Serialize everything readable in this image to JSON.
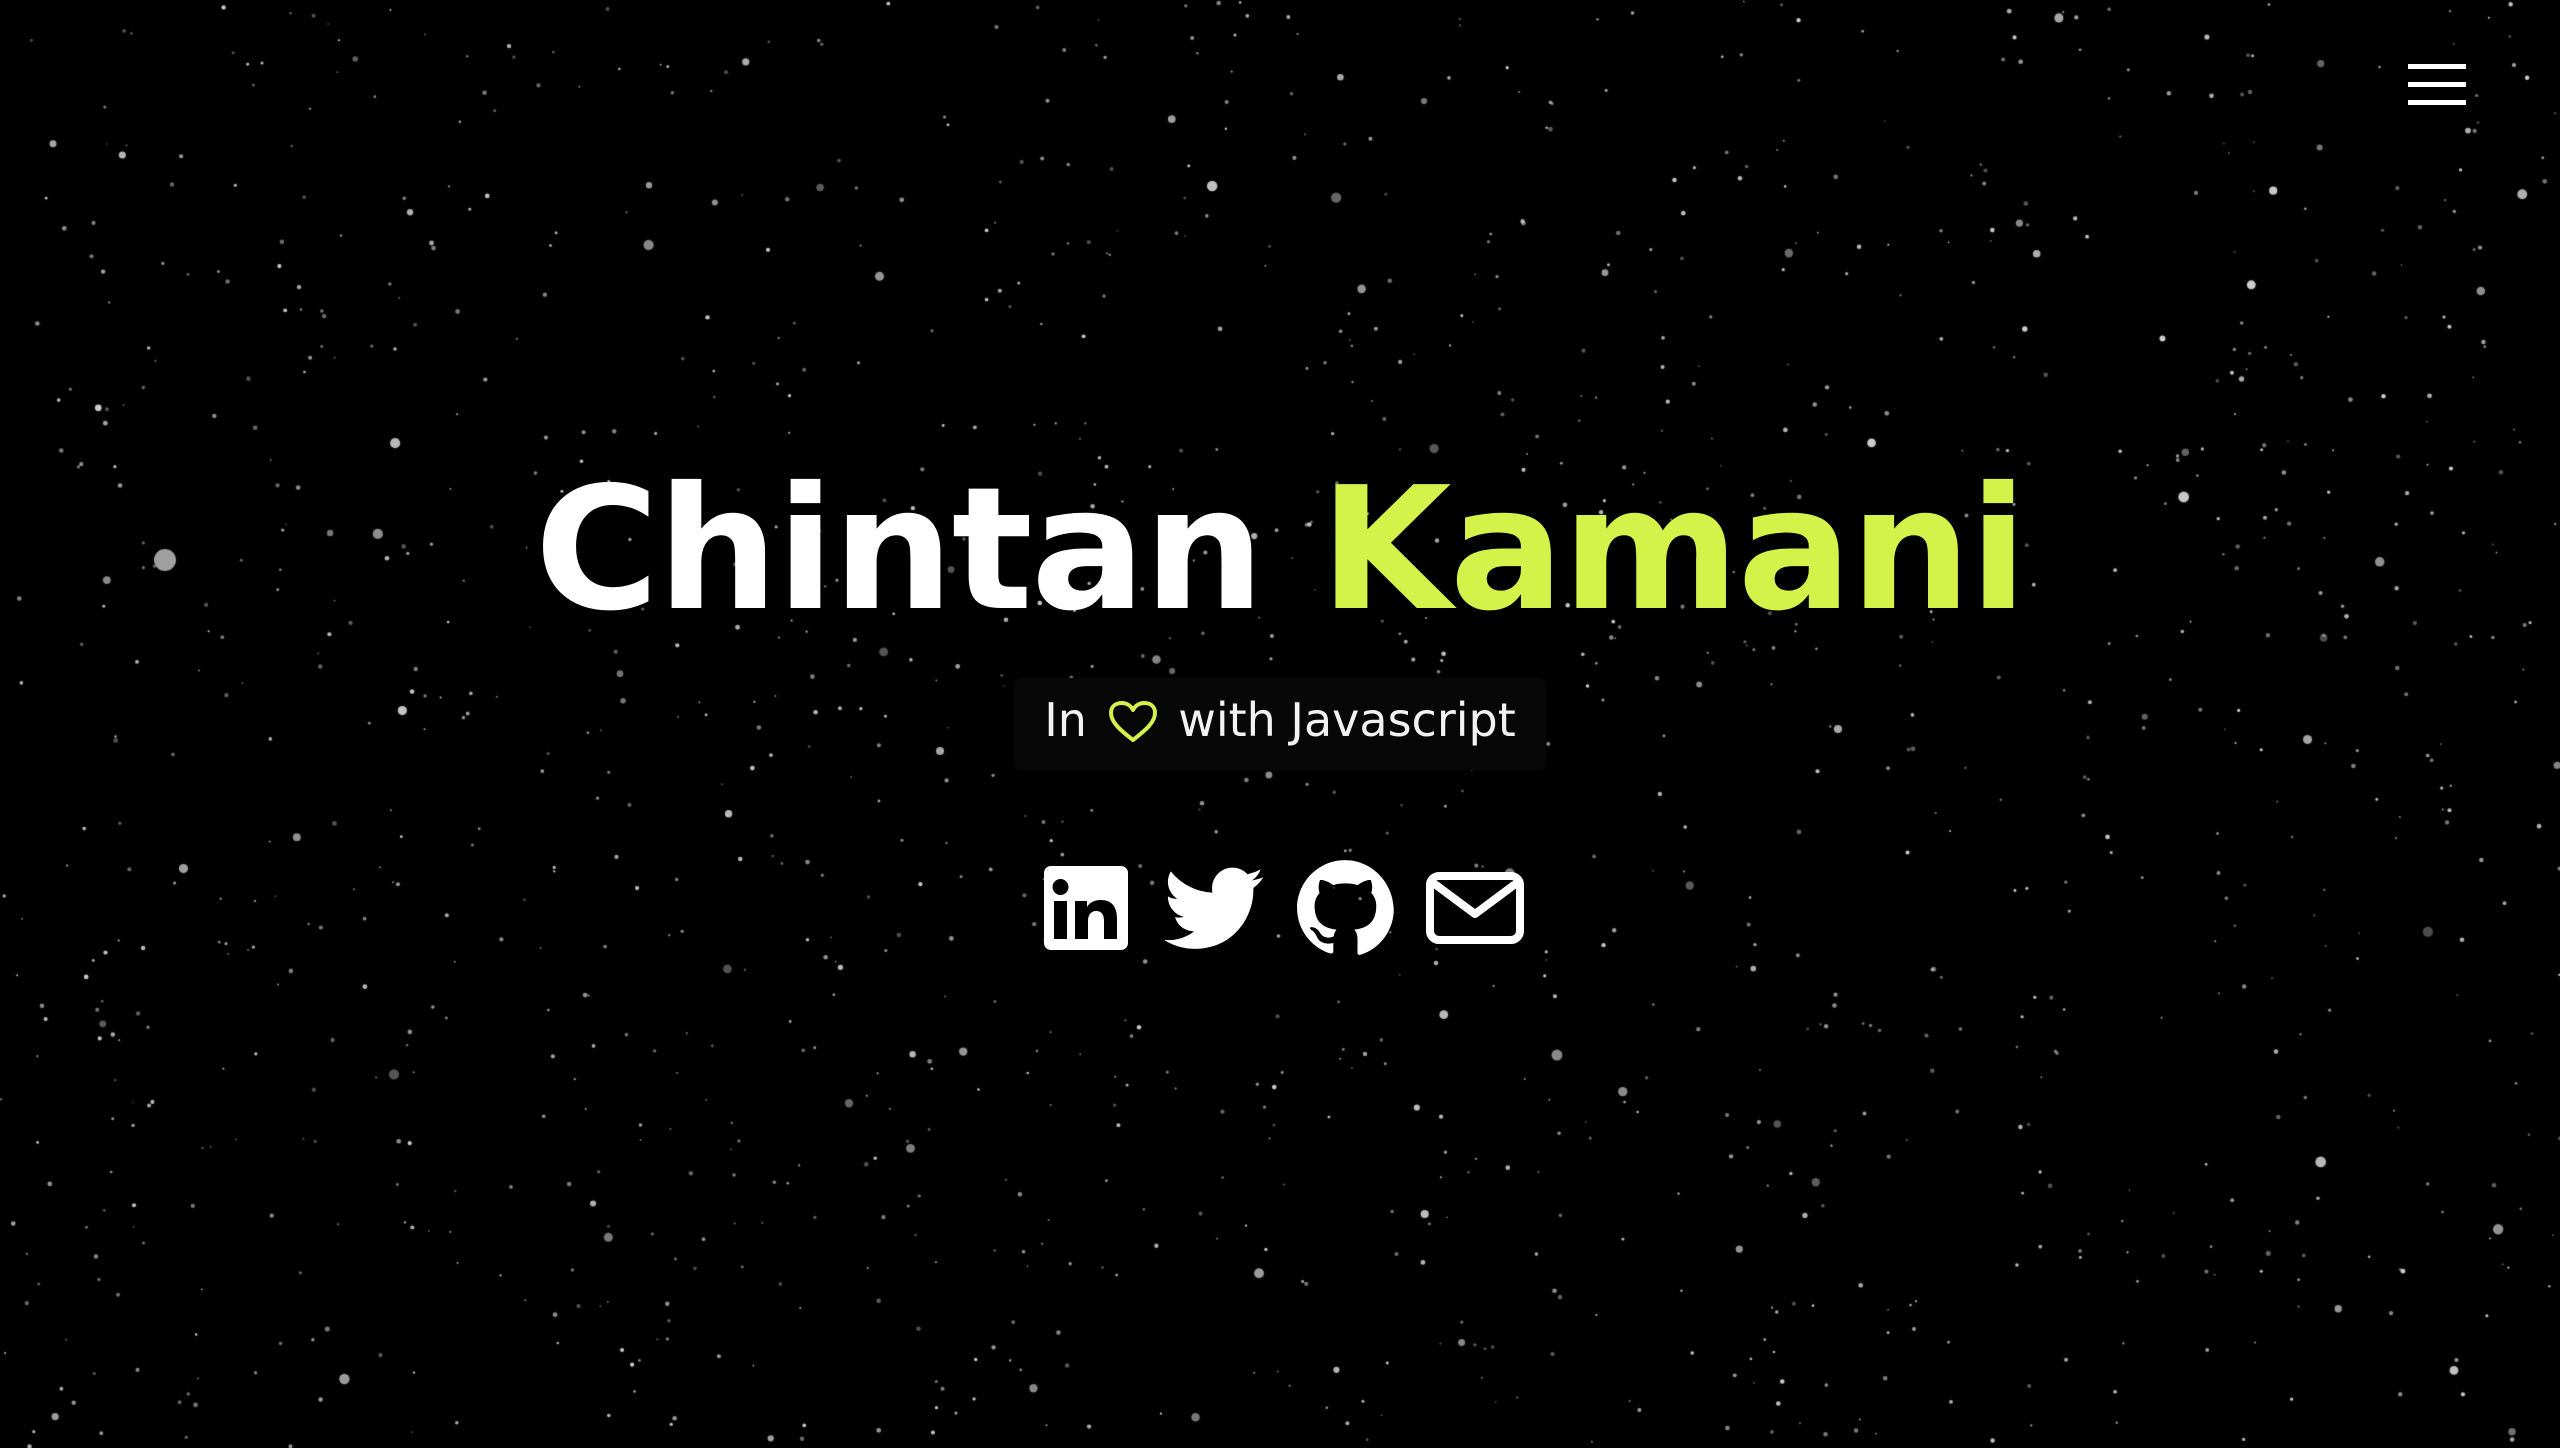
{
  "header": {
    "menu_icon": "hamburger-menu-icon"
  },
  "hero": {
    "first_name": "Chintan",
    "last_name": "Kamani",
    "tagline_before": "In",
    "tagline_icon": "heart-outline-icon",
    "tagline_after": "with Javascript"
  },
  "socials": [
    {
      "icon": "linkedin-icon"
    },
    {
      "icon": "twitter-icon"
    },
    {
      "icon": "github-icon"
    },
    {
      "icon": "mail-icon"
    }
  ],
  "colors": {
    "background": "#000000",
    "text": "#ffffff",
    "accent": "#d4f24a",
    "stars": "#d8d8d8"
  }
}
